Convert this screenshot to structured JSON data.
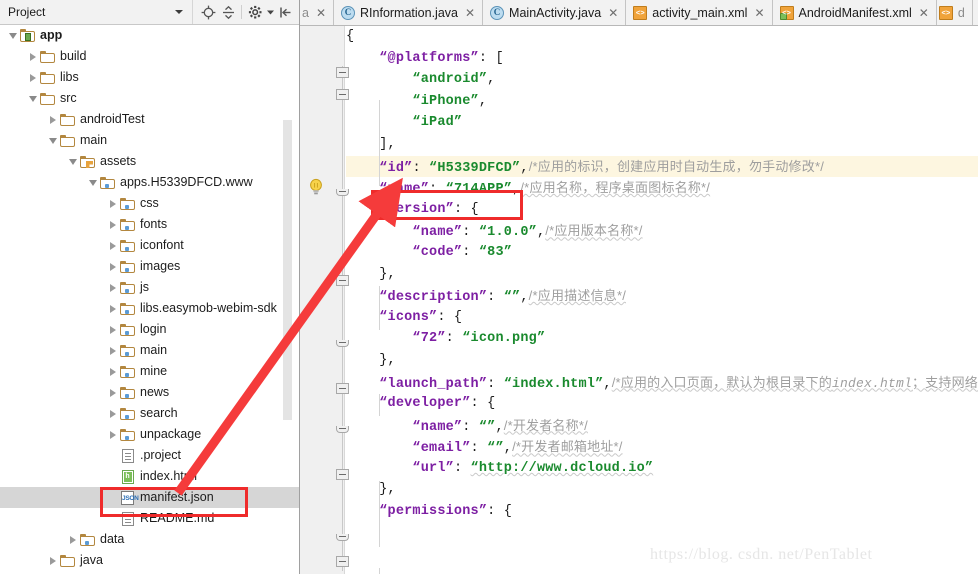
{
  "window": {
    "watermark": "https://blog. csdn. net/PenTablet"
  },
  "project_panel": {
    "combo_label": "Project",
    "toolbar": [
      {
        "name": "locate-icon",
        "title": "Select Opened File"
      },
      {
        "name": "collapse-all-icon",
        "title": "Collapse All"
      },
      {
        "name": "gear-icon",
        "title": "Settings"
      },
      {
        "name": "hide-panel-icon",
        "title": "Hide"
      }
    ],
    "tree": [
      {
        "label": "app",
        "depth": 0,
        "twisty": "expanded",
        "icon": "module-icon",
        "bold": true,
        "selected": false
      },
      {
        "label": "build",
        "depth": 1,
        "twisty": "collapsed",
        "icon": "folder-icon",
        "bold": false,
        "selected": false
      },
      {
        "label": "libs",
        "depth": 1,
        "twisty": "collapsed",
        "icon": "folder-icon",
        "bold": false,
        "selected": false
      },
      {
        "label": "src",
        "depth": 1,
        "twisty": "expanded",
        "icon": "folder-icon",
        "bold": false,
        "selected": false
      },
      {
        "label": "androidTest",
        "depth": 2,
        "twisty": "collapsed",
        "icon": "folder-icon",
        "bold": false,
        "selected": false
      },
      {
        "label": "main",
        "depth": 2,
        "twisty": "expanded",
        "icon": "folder-icon",
        "bold": false,
        "selected": false
      },
      {
        "label": "assets",
        "depth": 3,
        "twisty": "expanded",
        "icon": "assets-folder-icon",
        "bold": false,
        "selected": false
      },
      {
        "label": "apps.H5339DFCD.www",
        "depth": 4,
        "twisty": "expanded",
        "icon": "source-folder-icon",
        "bold": false,
        "selected": false
      },
      {
        "label": "css",
        "depth": 5,
        "twisty": "collapsed",
        "icon": "source-folder-icon",
        "bold": false,
        "selected": false
      },
      {
        "label": "fonts",
        "depth": 5,
        "twisty": "collapsed",
        "icon": "source-folder-icon",
        "bold": false,
        "selected": false
      },
      {
        "label": "iconfont",
        "depth": 5,
        "twisty": "collapsed",
        "icon": "source-folder-icon",
        "bold": false,
        "selected": false
      },
      {
        "label": "images",
        "depth": 5,
        "twisty": "collapsed",
        "icon": "source-folder-icon",
        "bold": false,
        "selected": false
      },
      {
        "label": "js",
        "depth": 5,
        "twisty": "collapsed",
        "icon": "source-folder-icon",
        "bold": false,
        "selected": false
      },
      {
        "label": "libs.easymob-webim-sdk",
        "depth": 5,
        "twisty": "collapsed",
        "icon": "source-folder-icon",
        "bold": false,
        "selected": false
      },
      {
        "label": "login",
        "depth": 5,
        "twisty": "collapsed",
        "icon": "source-folder-icon",
        "bold": false,
        "selected": false
      },
      {
        "label": "main",
        "depth": 5,
        "twisty": "collapsed",
        "icon": "source-folder-icon",
        "bold": false,
        "selected": false
      },
      {
        "label": "mine",
        "depth": 5,
        "twisty": "collapsed",
        "icon": "source-folder-icon",
        "bold": false,
        "selected": false
      },
      {
        "label": "news",
        "depth": 5,
        "twisty": "collapsed",
        "icon": "source-folder-icon",
        "bold": false,
        "selected": false
      },
      {
        "label": "search",
        "depth": 5,
        "twisty": "collapsed",
        "icon": "source-folder-icon",
        "bold": false,
        "selected": false
      },
      {
        "label": "unpackage",
        "depth": 5,
        "twisty": "collapsed",
        "icon": "source-folder-icon",
        "bold": false,
        "selected": false
      },
      {
        "label": ".project",
        "depth": 5,
        "twisty": "none",
        "icon": "file-icon",
        "bold": false,
        "selected": false
      },
      {
        "label": "index.html",
        "depth": 5,
        "twisty": "none",
        "icon": "html-file-icon",
        "bold": false,
        "selected": false
      },
      {
        "label": "manifest.json",
        "depth": 5,
        "twisty": "none",
        "icon": "json-file-icon",
        "bold": false,
        "selected": true
      },
      {
        "label": "README.md",
        "depth": 5,
        "twisty": "none",
        "icon": "md-file-icon",
        "bold": false,
        "selected": false
      },
      {
        "label": "data",
        "depth": 3,
        "twisty": "collapsed",
        "icon": "source-folder-icon",
        "bold": false,
        "selected": false
      },
      {
        "label": "java",
        "depth": 2,
        "twisty": "collapsed",
        "icon": "folder-icon",
        "bold": false,
        "selected": false
      }
    ]
  },
  "editor_tabs": [
    {
      "label": "a",
      "icon": "none",
      "partial": true,
      "close": "✕"
    },
    {
      "label": "RInformation.java",
      "icon": "java-class-icon",
      "partial": false,
      "close": "✕"
    },
    {
      "label": "MainActivity.java",
      "icon": "java-class-icon",
      "partial": false,
      "close": "✕"
    },
    {
      "label": "activity_main.xml",
      "icon": "xml-file-icon",
      "partial": false,
      "close": "✕"
    },
    {
      "label": "AndroidManifest.xml",
      "icon": "android-manifest-icon",
      "partial": false,
      "close": "✕"
    },
    {
      "label": "d",
      "icon": "xml-file-icon",
      "partial": true,
      "close": ""
    }
  ],
  "code": {
    "file": "manifest.json",
    "lines": [
      {
        "indent": 0,
        "parts": [
          {
            "t": "punct",
            "s": "{"
          }
        ]
      },
      {
        "indent": 1,
        "parts": [
          {
            "t": "key",
            "s": "“@platforms”"
          },
          {
            "t": "punct",
            "s": ": ["
          }
        ]
      },
      {
        "indent": 2,
        "parts": [
          {
            "t": "str",
            "s": "“android”"
          },
          {
            "t": "punct",
            "s": ","
          }
        ]
      },
      {
        "indent": 2,
        "parts": [
          {
            "t": "str",
            "s": "“iPhone”"
          },
          {
            "t": "punct",
            "s": ","
          }
        ]
      },
      {
        "indent": 2,
        "parts": [
          {
            "t": "str",
            "s": "“iPad”"
          }
        ]
      },
      {
        "indent": 1,
        "parts": [
          {
            "t": "punct",
            "s": "],"
          }
        ]
      },
      {
        "indent": 1,
        "highlight": true,
        "parts": [
          {
            "t": "key",
            "s": "“id”"
          },
          {
            "t": "punct",
            "s": ": "
          },
          {
            "t": "str",
            "s": "“H5339DFCD”"
          },
          {
            "t": "punct",
            "s": ","
          },
          {
            "t": "comment",
            "s": "/*应用的标识，创建应用时自动生成，勿手动修改*/"
          }
        ]
      },
      {
        "indent": 1,
        "parts": [
          {
            "t": "key",
            "s": "“name”"
          },
          {
            "t": "punct",
            "s": ": "
          },
          {
            "t": "str",
            "s": "“714APP”"
          },
          {
            "t": "punct",
            "s": ","
          },
          {
            "t": "comment-sq",
            "s": "/*应用名称，程序桌面图标名称*/"
          }
        ]
      },
      {
        "indent": 1,
        "parts": [
          {
            "t": "key",
            "s": "“version”"
          },
          {
            "t": "punct",
            "s": ": {"
          }
        ]
      },
      {
        "indent": 2,
        "parts": [
          {
            "t": "key",
            "s": "“name”"
          },
          {
            "t": "punct",
            "s": ": "
          },
          {
            "t": "str",
            "s": "“1.0.0”"
          },
          {
            "t": "punct",
            "s": ","
          },
          {
            "t": "comment-sq",
            "s": "/*应用版本名称*/"
          }
        ]
      },
      {
        "indent": 2,
        "parts": [
          {
            "t": "key",
            "s": "“code”"
          },
          {
            "t": "punct",
            "s": ": "
          },
          {
            "t": "str",
            "s": "“83”"
          }
        ]
      },
      {
        "indent": 1,
        "parts": [
          {
            "t": "punct",
            "s": "},"
          }
        ]
      },
      {
        "indent": 1,
        "parts": [
          {
            "t": "key",
            "s": "“description”"
          },
          {
            "t": "punct",
            "s": ": "
          },
          {
            "t": "str",
            "s": "“”"
          },
          {
            "t": "punct",
            "s": ","
          },
          {
            "t": "comment-sq",
            "s": "/*应用描述信息*/"
          }
        ]
      },
      {
        "indent": 1,
        "parts": [
          {
            "t": "key",
            "s": "“icons”"
          },
          {
            "t": "punct",
            "s": ": {"
          }
        ]
      },
      {
        "indent": 2,
        "parts": [
          {
            "t": "key",
            "s": "“72”"
          },
          {
            "t": "punct",
            "s": ": "
          },
          {
            "t": "str",
            "s": "“icon.png”"
          }
        ]
      },
      {
        "indent": 1,
        "parts": [
          {
            "t": "punct",
            "s": "},"
          }
        ]
      },
      {
        "indent": 1,
        "parts": [
          {
            "t": "key",
            "s": "“launch_path”"
          },
          {
            "t": "punct",
            "s": ": "
          },
          {
            "t": "str",
            "s": "“index.html”"
          },
          {
            "t": "punct",
            "s": ","
          },
          {
            "t": "comment-sq-it",
            "s": "/*应用的入口页面，默认为根目录下的",
            "it": "index.html",
            "s2": "；支持网络"
          }
        ]
      },
      {
        "indent": 1,
        "parts": [
          {
            "t": "key",
            "s": "“developer”"
          },
          {
            "t": "punct",
            "s": ": {"
          }
        ]
      },
      {
        "indent": 2,
        "parts": [
          {
            "t": "key",
            "s": "“name”"
          },
          {
            "t": "punct",
            "s": ": "
          },
          {
            "t": "str",
            "s": "“”"
          },
          {
            "t": "punct",
            "s": ","
          },
          {
            "t": "comment-sq",
            "s": "/*开发者名称*/"
          }
        ]
      },
      {
        "indent": 2,
        "parts": [
          {
            "t": "key",
            "s": "“email”"
          },
          {
            "t": "punct",
            "s": ": "
          },
          {
            "t": "str",
            "s": "“”"
          },
          {
            "t": "punct",
            "s": ","
          },
          {
            "t": "comment-sq",
            "s": "/*开发者邮箱地址*/"
          }
        ]
      },
      {
        "indent": 2,
        "parts": [
          {
            "t": "key",
            "s": "“url”"
          },
          {
            "t": "punct",
            "s": ": "
          },
          {
            "t": "str-sq",
            "s": "“http://www.dcloud.io”"
          }
        ]
      },
      {
        "indent": 1,
        "parts": [
          {
            "t": "punct",
            "s": "},"
          }
        ]
      },
      {
        "indent": 1,
        "parts": [
          {
            "t": "key",
            "s": "“permissions”"
          },
          {
            "t": "punct",
            "s": ": {"
          }
        ]
      }
    ]
  },
  "colors": {
    "accent_red": "#ef2b2b",
    "string_green": "#1a8a2e",
    "key_purple": "#7d1fa3",
    "comment_gray": "#9e9e9e",
    "highlight_row": "#fdf6e0",
    "selection_gray": "#d6d6d6"
  }
}
